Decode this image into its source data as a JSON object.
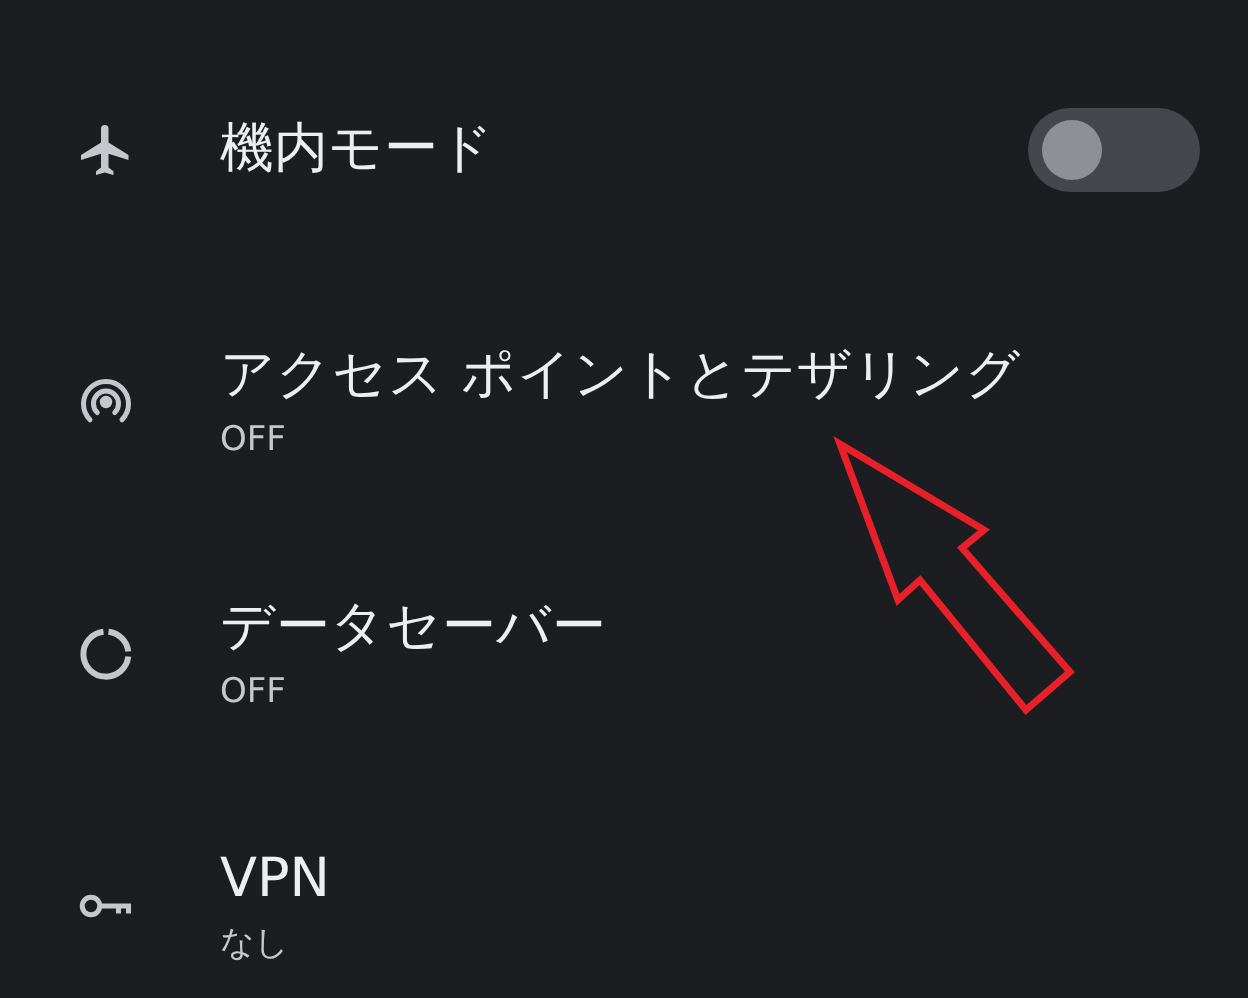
{
  "settings": [
    {
      "kind": "toggle",
      "title": "機内モード",
      "on": false
    },
    {
      "kind": "link",
      "title": "アクセス ポイントとテザリング",
      "summary": "OFF"
    },
    {
      "kind": "link",
      "title": "データセーバー",
      "summary": "OFF"
    },
    {
      "kind": "link",
      "title": "VPN",
      "summary": "なし"
    }
  ]
}
